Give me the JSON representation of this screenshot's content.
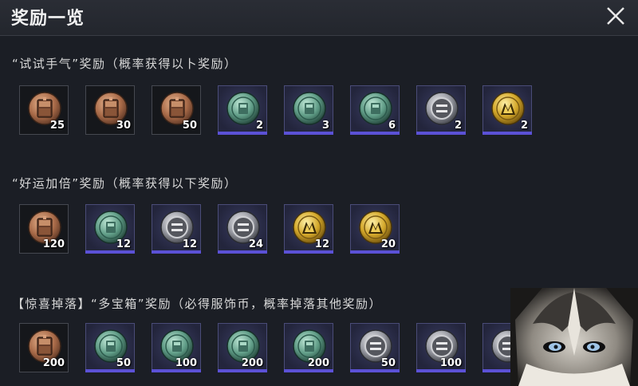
{
  "header": {
    "title": "奖励一览",
    "close_icon": "close-icon"
  },
  "sections": [
    {
      "label": "“试试手气”奖励（概率获得以卜奖励）",
      "items": [
        {
          "icon": "bronze-crate-icon",
          "count": "25"
        },
        {
          "icon": "bronze-crate-icon",
          "count": "30"
        },
        {
          "icon": "bronze-crate-icon",
          "count": "50"
        },
        {
          "icon": "green-coin-icon",
          "count": "2"
        },
        {
          "icon": "green-coin-icon",
          "count": "3"
        },
        {
          "icon": "green-coin-icon",
          "count": "6"
        },
        {
          "icon": "silver-coin-icon",
          "count": "2"
        },
        {
          "icon": "gold-coin-icon",
          "count": "2"
        }
      ]
    },
    {
      "label": "“好运加倍”奖励（概率获得以下奖励）",
      "items": [
        {
          "icon": "bronze-crate-icon",
          "count": "120"
        },
        {
          "icon": "green-coin-icon",
          "count": "12"
        },
        {
          "icon": "silver-coin-icon",
          "count": "12"
        },
        {
          "icon": "silver-coin-icon",
          "count": "24"
        },
        {
          "icon": "gold-coin-icon",
          "count": "12"
        },
        {
          "icon": "gold-coin-icon",
          "count": "20"
        }
      ]
    },
    {
      "label": "【惊喜掉落】“多宝箱”奖励（必得服饰币，概率掉落其他奖励）",
      "items": [
        {
          "icon": "bronze-crate-icon",
          "count": "200"
        },
        {
          "icon": "green-coin-icon",
          "count": "50"
        },
        {
          "icon": "green-coin-icon",
          "count": "100"
        },
        {
          "icon": "green-coin-icon",
          "count": "200"
        },
        {
          "icon": "green-coin-icon",
          "count": "200"
        },
        {
          "icon": "silver-coin-icon",
          "count": "50"
        },
        {
          "icon": "silver-coin-icon",
          "count": "100"
        },
        {
          "icon": "silver-coin-icon",
          "count": ""
        }
      ]
    }
  ],
  "overlay": {
    "icon": "husky-face-icon"
  }
}
